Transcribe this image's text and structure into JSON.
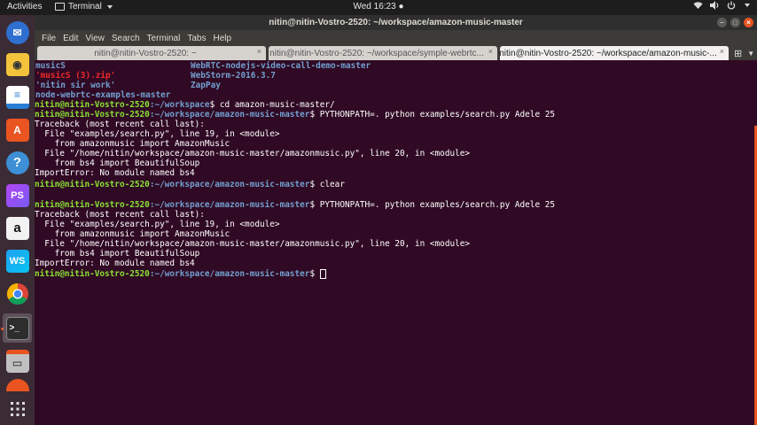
{
  "panel": {
    "activities": "Activities",
    "app_name": "Terminal",
    "clock": "Wed 16:23 ●"
  },
  "window": {
    "title": "nitin@nitin-Vostro-2520: ~/workspace/amazon-music-master",
    "menu": [
      "File",
      "Edit",
      "View",
      "Search",
      "Terminal",
      "Tabs",
      "Help"
    ],
    "tabs": [
      {
        "label": "nitin@nitin-Vostro-2520: ~"
      },
      {
        "label": "nitin@nitin-Vostro-2520: ~/workspace/symple-webrtc..."
      },
      {
        "label": "nitin@nitin-Vostro-2520: ~/workspace/amazon-music-..."
      }
    ]
  },
  "dock": [
    {
      "name": "thunderbird-icon",
      "color": "#2f6fcf"
    },
    {
      "name": "rhythmbox-icon",
      "color": "#f3c33c"
    },
    {
      "name": "libreoffice-writer-icon",
      "color": "#2a7fd4"
    },
    {
      "name": "ubuntu-software-icon",
      "color": "#e95420"
    },
    {
      "name": "help-icon",
      "color": "#3d8fd6"
    },
    {
      "name": "phpstorm-icon",
      "color": "#b345f1"
    },
    {
      "name": "amazon-icon",
      "color": "#f2f2f2"
    },
    {
      "name": "webstorm-icon",
      "color": "#1ea2ef"
    },
    {
      "name": "chrome-icon",
      "color": "#4caf50"
    },
    {
      "name": "terminal-icon",
      "color": "#2d2d2d"
    },
    {
      "name": "files-icon",
      "color": "#c0c0c0"
    },
    {
      "name": "partial-icon",
      "color": "#e95420"
    }
  ],
  "terminal": {
    "ls": {
      "left": [
        "musicS",
        "'musicS (3).zip'",
        "'nitin sir work'",
        "node-webrtc-examples-master"
      ],
      "right": [
        "WebRTC-nodejs-video-call-demo-master",
        "WebStorm-2016.3.7",
        "ZapPay"
      ]
    },
    "user": "nitin@nitin-Vostro-2520",
    "home_path": ":~/workspace",
    "path": ":~/workspace/amazon-music-master",
    "cmd_cd": "$ cd amazon-music-master/",
    "cmd_run": "$ PYTHONPATH=. python examples/search.py Adele 25",
    "cmd_clear": "$ clear",
    "prompt_end": "$ ",
    "traceback": [
      "Traceback (most recent call last):",
      "  File \"examples/search.py\", line 19, in <module>",
      "    from amazonmusic import AmazonMusic",
      "  File \"/home/nitin/workspace/amazon-music-master/amazonmusic.py\", line 20, in <module>",
      "    from bs4 import BeautifulSoup",
      "ImportError: No module named bs4"
    ]
  }
}
